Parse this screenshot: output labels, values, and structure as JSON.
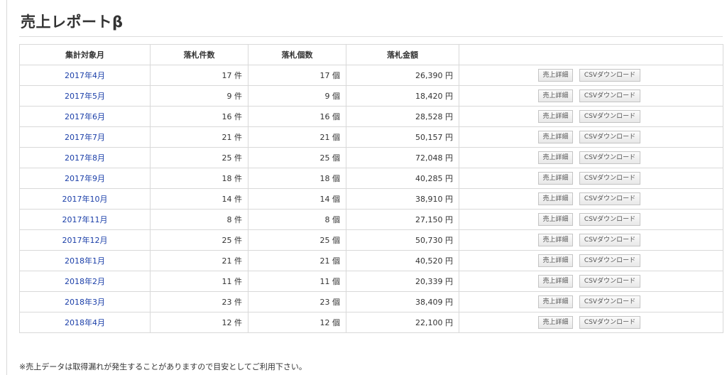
{
  "page": {
    "title": "売上レポートβ",
    "footnote": "※売上データは取得漏れが発生することがありますので目安としてご利用下さい。"
  },
  "table": {
    "headers": [
      "集計対象月",
      "落札件数",
      "落札個数",
      "落札金額",
      ""
    ],
    "detail_label": "売上詳細",
    "csv_label": "CSVダウンロード",
    "rows": [
      {
        "month": "2017年4月",
        "count": "17 件",
        "items": "17 個",
        "amount": "26,390 円"
      },
      {
        "month": "2017年5月",
        "count": "9 件",
        "items": "9 個",
        "amount": "18,420 円"
      },
      {
        "month": "2017年6月",
        "count": "16 件",
        "items": "16 個",
        "amount": "28,528 円"
      },
      {
        "month": "2017年7月",
        "count": "21 件",
        "items": "21 個",
        "amount": "50,157 円"
      },
      {
        "month": "2017年8月",
        "count": "25 件",
        "items": "25 個",
        "amount": "72,048 円"
      },
      {
        "month": "2017年9月",
        "count": "18 件",
        "items": "18 個",
        "amount": "40,285 円"
      },
      {
        "month": "2017年10月",
        "count": "14 件",
        "items": "14 個",
        "amount": "38,910 円"
      },
      {
        "month": "2017年11月",
        "count": "8 件",
        "items": "8 個",
        "amount": "27,150 円"
      },
      {
        "month": "2017年12月",
        "count": "25 件",
        "items": "25 個",
        "amount": "50,730 円"
      },
      {
        "month": "2018年1月",
        "count": "21 件",
        "items": "21 個",
        "amount": "40,520 円"
      },
      {
        "month": "2018年2月",
        "count": "11 件",
        "items": "11 個",
        "amount": "20,339 円"
      },
      {
        "month": "2018年3月",
        "count": "23 件",
        "items": "23 個",
        "amount": "38,409 円"
      },
      {
        "month": "2018年4月",
        "count": "12 件",
        "items": "12 個",
        "amount": "22,100 円"
      }
    ]
  },
  "colors": {
    "link": "#1a3ea8",
    "border": "#d9d9d9",
    "text": "#333333"
  }
}
